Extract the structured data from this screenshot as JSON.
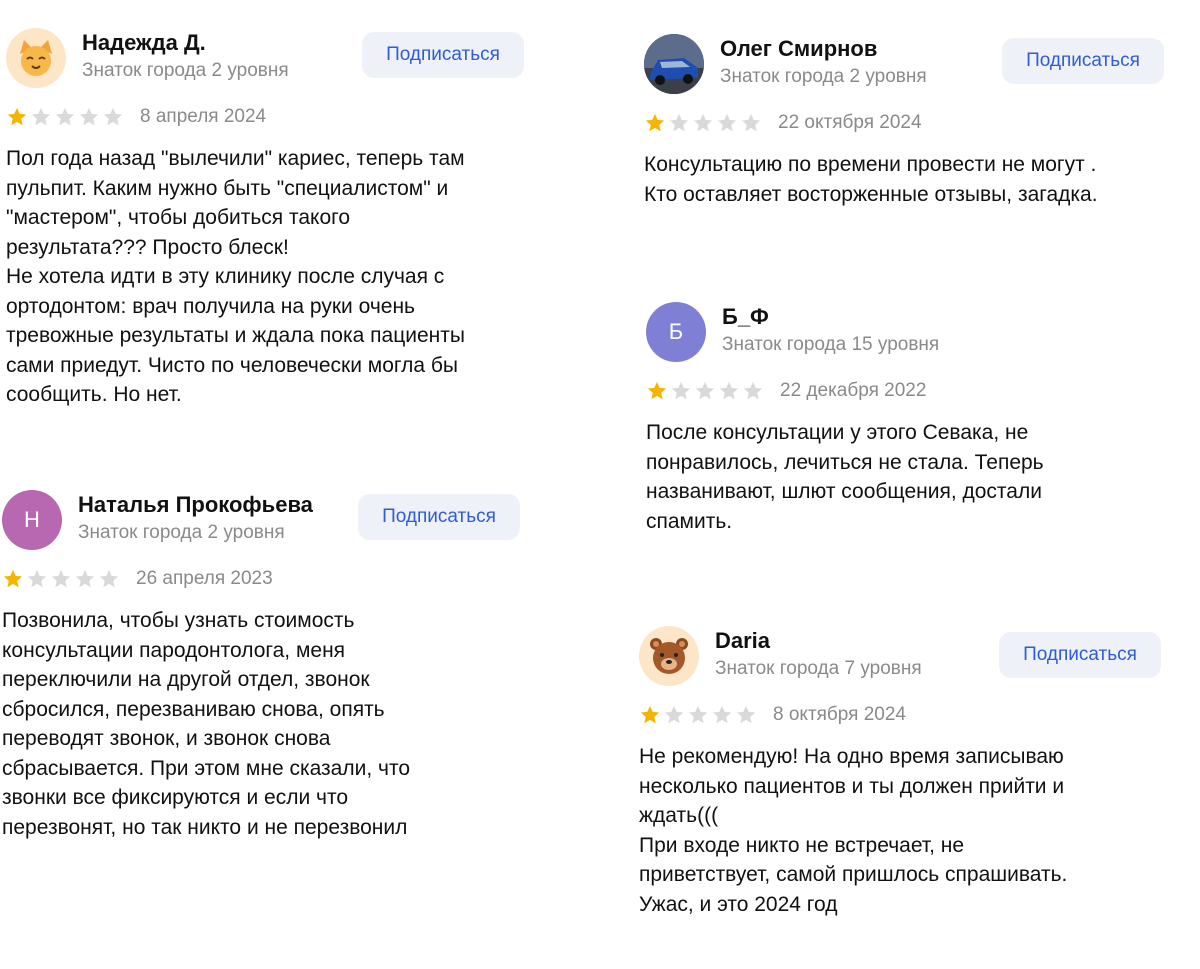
{
  "subscribe_label": "Подписаться",
  "colors": {
    "star_filled": "#f5b400",
    "star_empty": "#d9d9d9",
    "button_bg": "#eef2f8",
    "button_text": "#2f5bd7",
    "avatar_n": "#b868b0",
    "avatar_b": "#7f7fd6"
  },
  "reviews": [
    {
      "name": "Надежда Д.",
      "level": "Знаток города 2 уровня",
      "avatar_icon": "cat-emoji-icon",
      "avatar_glyph": "🐱",
      "rating": 1,
      "date": "8 апреля 2024",
      "text": "Пол года назад \"вылечили\" кариес, теперь там\nпульпит. Каким нужно быть \"специалистом\" и\n\"мастером\", чтобы добиться такого\nрезультата??? Просто блеск!\nНе хотела идти в эту клинику после случая с\nортодонтом: врач получила на руки очень\nтревожные результаты и ждала пока пациенты\nсами приедут. Чисто по человечески могла бы\nсообщить. Но нет."
    },
    {
      "name": "Наталья Прокофьева",
      "level": "Знаток города 2 уровня",
      "avatar_letter": "Н",
      "rating": 1,
      "date": "26 апреля 2023",
      "text": "Позвонила, чтобы узнать стоимость\nконсультации пародонтолога, меня\nпереключили на другой отдел, звонок\nсбросился, перезваниваю снова, опять\nпереводят звонок, и звонок снова\nсбрасывается. При этом мне сказали, что\nзвонки все фиксируются и если что\nперезвонят, но так никто и не перезвонил"
    },
    {
      "name": "Олег Смирнов",
      "level": "Знаток города 2 уровня",
      "avatar_icon": "car-photo-icon",
      "rating": 1,
      "date": "22 октября 2024",
      "text": "Консультацию по времени провести не могут .\nКто оставляет восторженные отзывы, загадка."
    },
    {
      "name": "Б_Ф",
      "level": "Знаток города 15 уровня",
      "avatar_letter": "Б",
      "rating": 1,
      "date": "22 декабря 2022",
      "text": "После консультации у этого Севака, не\nпонравилось, лечиться не стала. Теперь\nназванивают, шлют сообщения, достали\nспамить."
    },
    {
      "name": "Daria",
      "level": "Знаток города 7 уровня",
      "avatar_icon": "bear-emoji-icon",
      "avatar_glyph": "🐻",
      "rating": 1,
      "date": "8 октября 2024",
      "text": "Не рекомендую! На одно время записываю\nнесколько пациентов и ты должен прийти и\nждать(((\nПри входе никто не встречает, не\nприветствует, самой пришлось спрашивать.\nУжас, и это 2024 год"
    }
  ]
}
